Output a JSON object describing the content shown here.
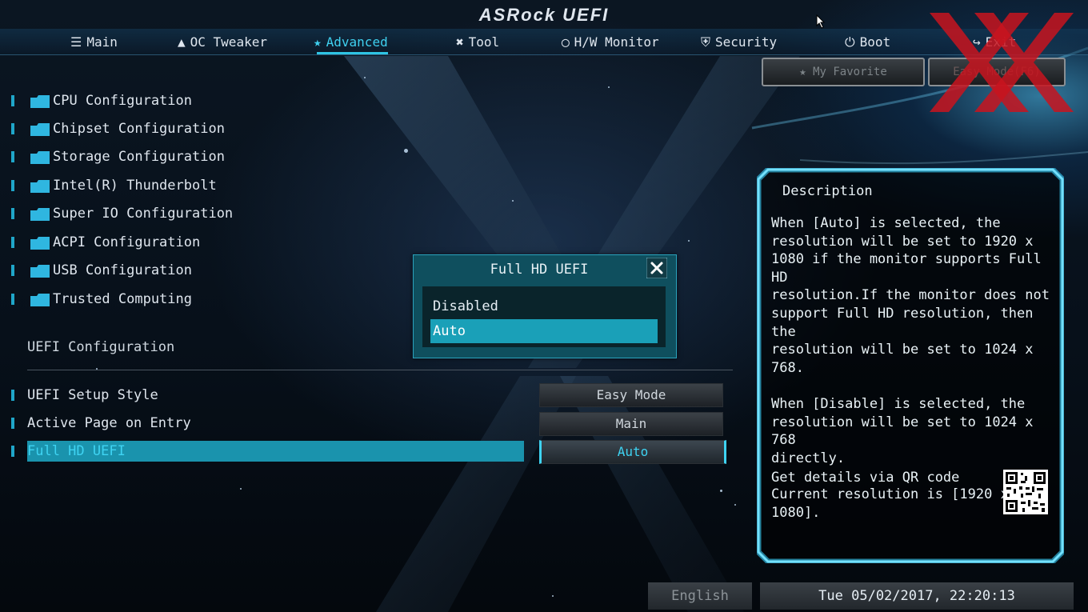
{
  "brand": "ASRock UEFI",
  "tabs": [
    {
      "label": "Main",
      "icon": "list-icon"
    },
    {
      "label": "OC Tweaker",
      "icon": "rocket-icon"
    },
    {
      "label": "Advanced",
      "icon": "star-icon",
      "active": true
    },
    {
      "label": "Tool",
      "icon": "tools-icon"
    },
    {
      "label": "H/W Monitor",
      "icon": "monitor-gauge-icon"
    },
    {
      "label": "Security",
      "icon": "shield-icon"
    },
    {
      "label": "Boot",
      "icon": "power-icon"
    },
    {
      "label": "Exit",
      "icon": "exit-icon"
    }
  ],
  "buttons": {
    "favorite": "My Favorite",
    "easy_mode": "Easy Mode(F6)"
  },
  "menu": [
    "CPU Configuration",
    "Chipset Configuration",
    "Storage Configuration",
    "Intel(R) Thunderbolt",
    "Super IO Configuration",
    "ACPI Configuration",
    "USB Configuration",
    "Trusted Computing"
  ],
  "section_title": "UEFI Configuration",
  "settings": [
    {
      "label": "UEFI Setup Style",
      "value": "Easy Mode"
    },
    {
      "label": "Active Page on Entry",
      "value": "Main"
    },
    {
      "label": "Full HD UEFI",
      "value": "Auto",
      "selected": true
    }
  ],
  "popup": {
    "title": "Full HD UEFI",
    "options": [
      "Disabled",
      "Auto"
    ],
    "selected": "Auto"
  },
  "description": {
    "title": "Description",
    "text": "When [Auto] is selected, the\nresolution will be set to 1920 x\n1080 if the monitor supports Full HD\nresolution.If the monitor does not\nsupport Full HD resolution, then the\nresolution will be set to 1024 x 768.\n\nWhen [Disable] is selected, the\nresolution will be set to 1024 x 768\ndirectly.\n\nCurrent resolution is [1920 x 1080].",
    "qr_label": "Get details via QR code"
  },
  "footer": {
    "language": "English",
    "datetime": "Tue 05/02/2017, 22:20:13"
  },
  "colors": {
    "accent": "#1aa0b8",
    "active_tab": "#3fd0ef",
    "watermark": "#c8141e"
  }
}
